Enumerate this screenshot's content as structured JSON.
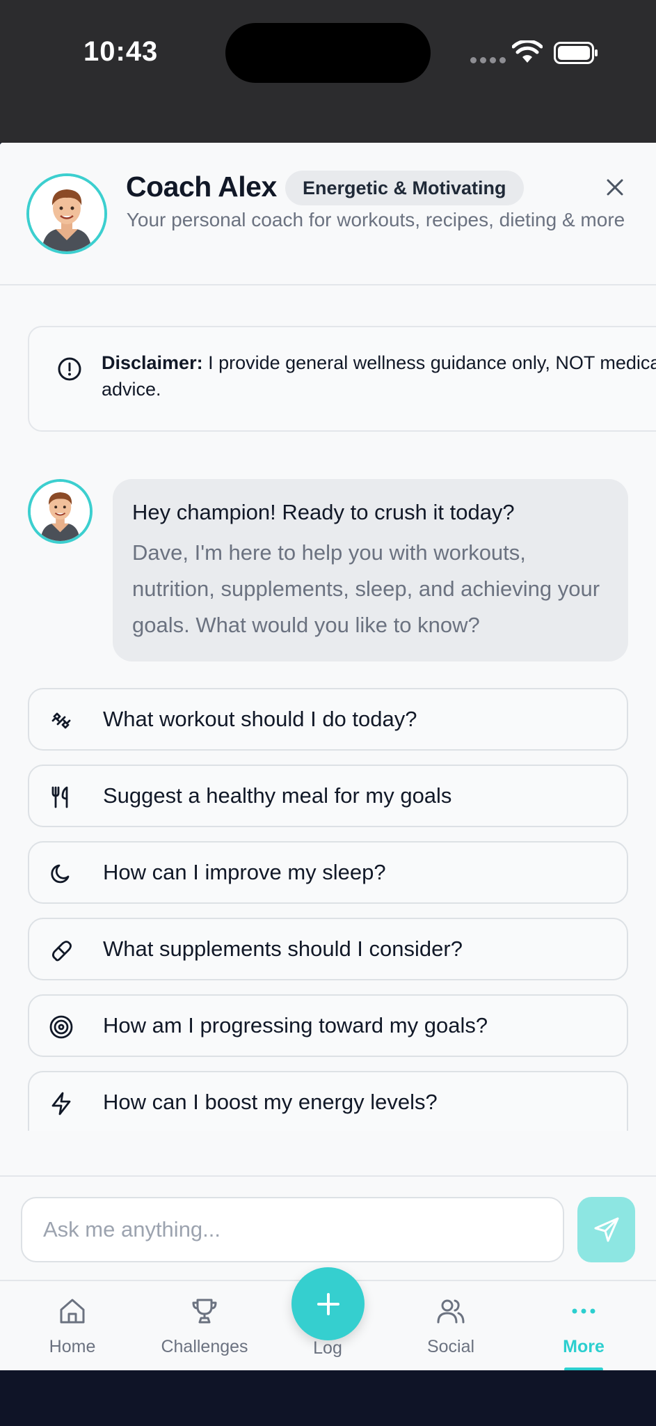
{
  "status_bar": {
    "time": "10:43"
  },
  "header": {
    "coach_name": "Coach Alex",
    "persona_badge": "Energetic & Motivating",
    "subtitle": "Your personal coach for workouts, recipes, dieting & more"
  },
  "disclaimer": {
    "label": "Disclaimer:",
    "text": " I provide general wellness guidance only, NOT medical advice."
  },
  "greeting": {
    "title": "Hey champion! Ready to crush it today?",
    "body": "Dave, I'm here to help you with workouts, nutrition, supplements, sleep, and achieving your goals. What would you like to know?"
  },
  "suggestions": [
    {
      "icon": "dumbbell-icon",
      "label": "What workout should I do today?"
    },
    {
      "icon": "utensils-icon",
      "label": "Suggest a healthy meal for my goals"
    },
    {
      "icon": "moon-icon",
      "label": "How can I improve my sleep?"
    },
    {
      "icon": "pill-icon",
      "label": "What supplements should I consider?"
    },
    {
      "icon": "target-icon",
      "label": "How am I progressing toward my goals?"
    },
    {
      "icon": "bolt-icon",
      "label": "How can I boost my energy levels?"
    }
  ],
  "input": {
    "placeholder": "Ask me anything..."
  },
  "tabbar": {
    "home": "Home",
    "challenges": "Challenges",
    "log": "Log",
    "social": "Social",
    "more": "More",
    "active": "More"
  },
  "colors": {
    "accent": "#35cfcf",
    "send_button": "#8de6e2",
    "bubble": "#e9ebee"
  }
}
